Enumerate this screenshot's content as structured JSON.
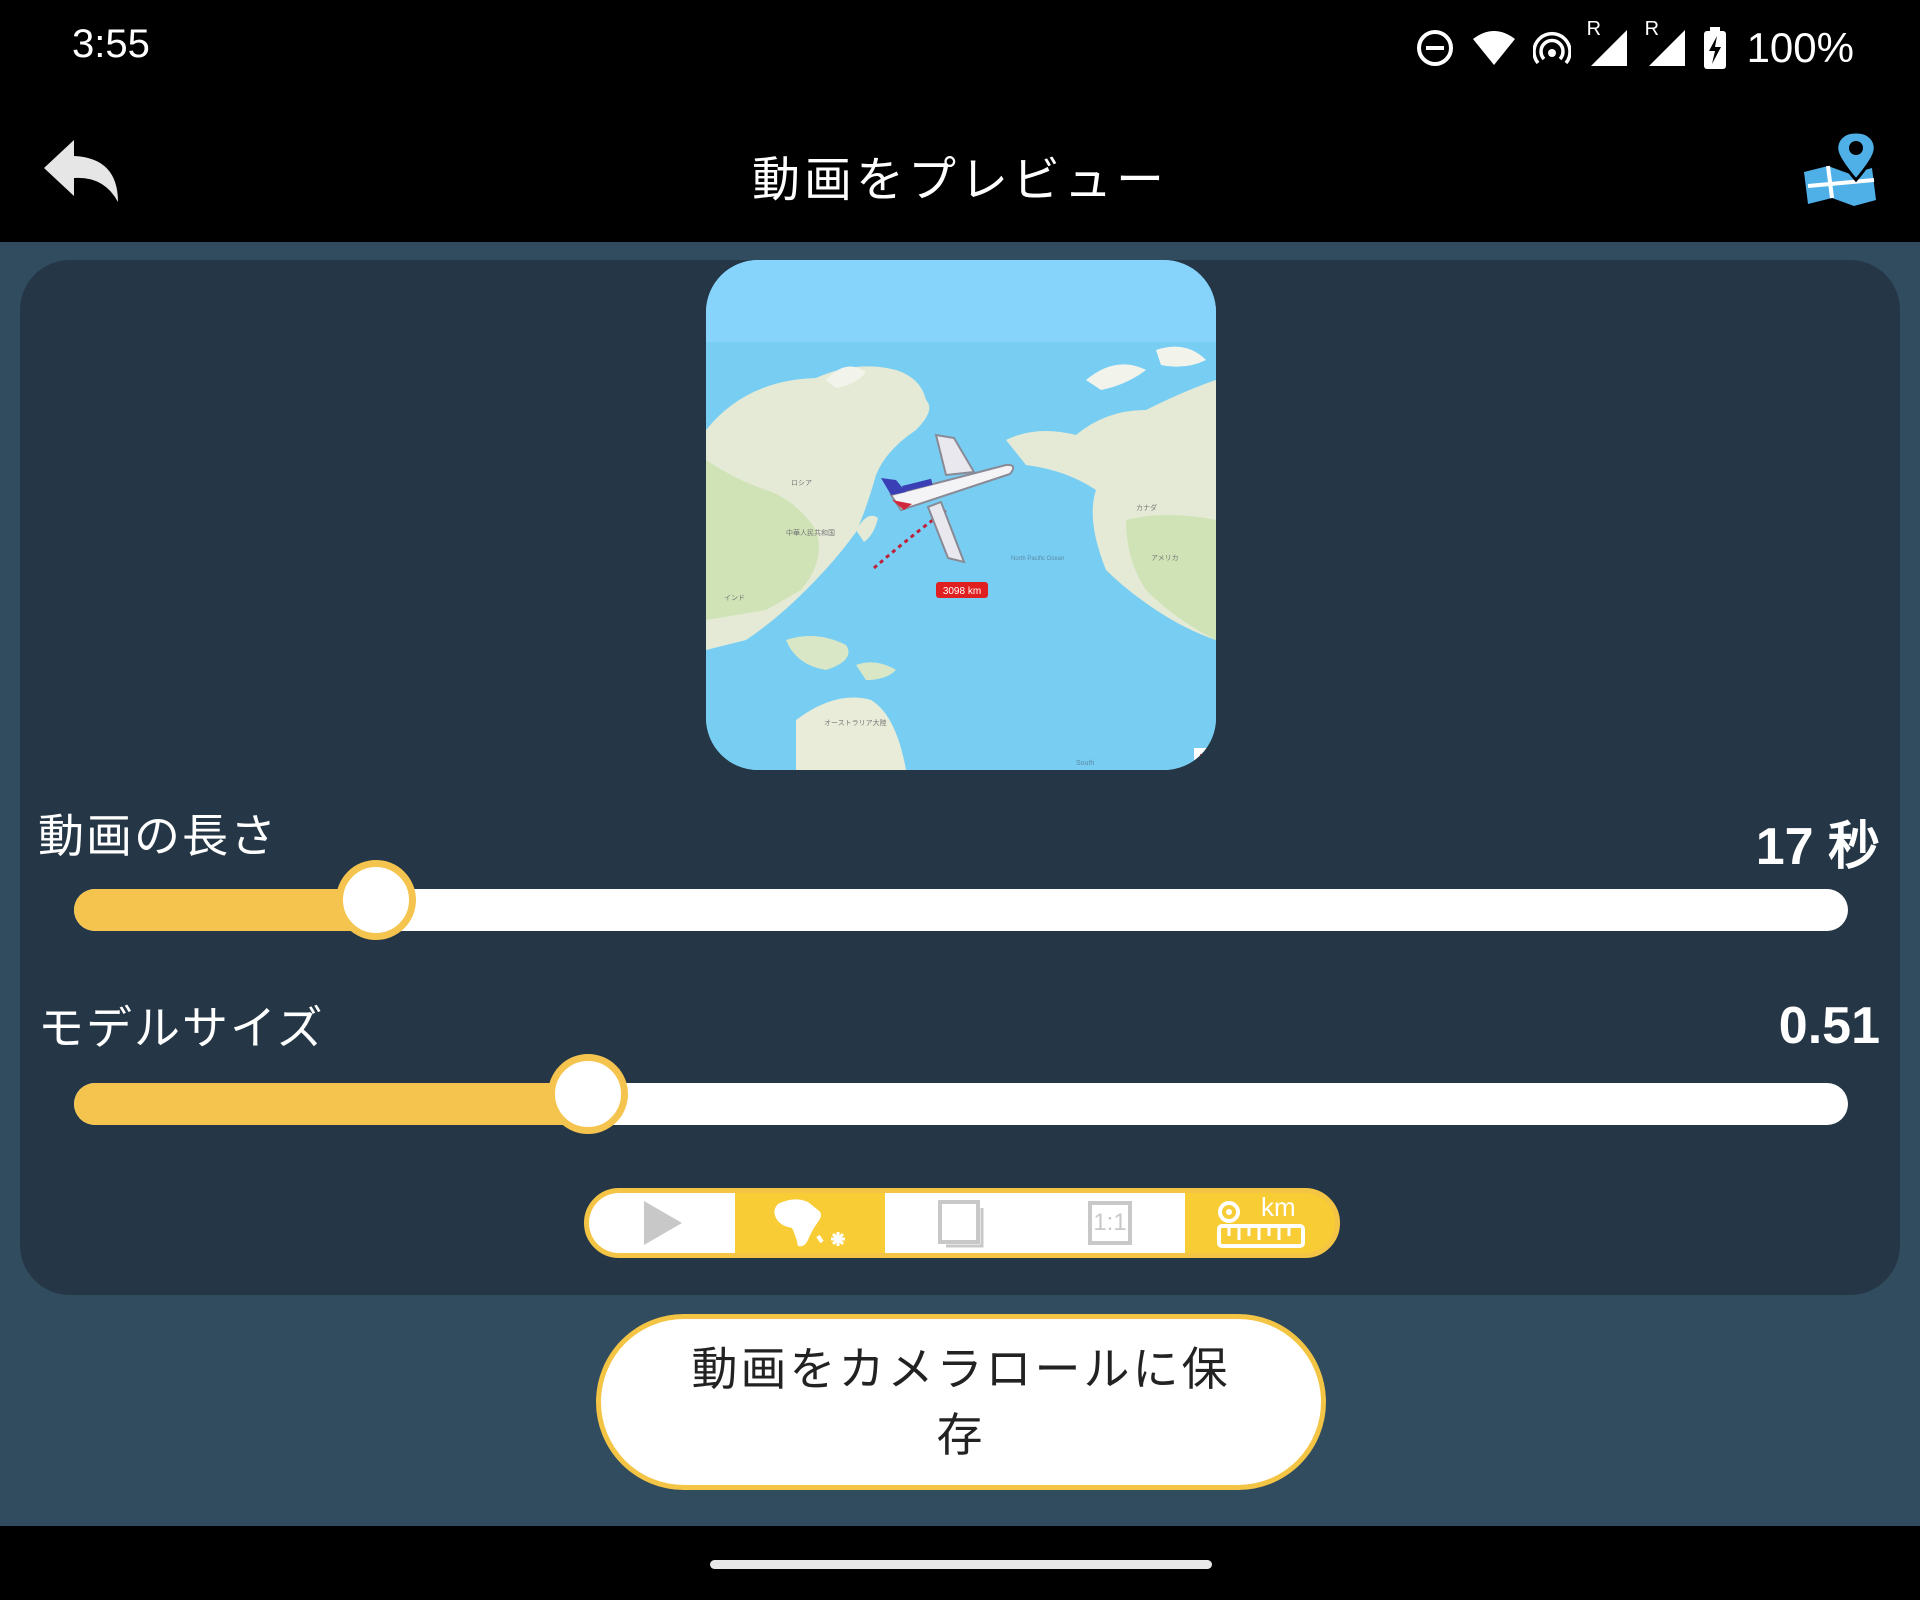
{
  "status_bar": {
    "time": "3:55",
    "battery": "100%",
    "roaming_label_1": "R",
    "roaming_label_2": "R"
  },
  "app_bar": {
    "title": "動画をプレビュー",
    "back_icon": "reply-arrow-icon",
    "action_icon": "map-location-pin-icon"
  },
  "preview": {
    "distance_label": "3098 km",
    "region_labels": [
      "ロシア",
      "中華人民共和国",
      "インド",
      "アメリカ",
      "カナダ",
      "オーストラリア大陸",
      "North Pacific Ocean",
      "South"
    ]
  },
  "sliders": {
    "duration": {
      "label": "動画の長さ",
      "value": "17 秒",
      "fraction": 0.17
    },
    "model_size": {
      "label": "モデルサイズ",
      "value": "0.51",
      "fraction": 0.29
    }
  },
  "segments": [
    {
      "icon": "play-icon",
      "selected": false
    },
    {
      "icon": "africa-map-icon",
      "selected": true
    },
    {
      "icon": "frame-icon",
      "selected": false
    },
    {
      "icon": "aspect-ratio-icon",
      "label": "1:1",
      "selected": false
    },
    {
      "icon": "distance-ruler-icon",
      "label": "km",
      "selected": true
    }
  ],
  "save_button": {
    "label": "動画をカメラロールに保存"
  },
  "colors": {
    "accent": "#f4c44e",
    "background": "#314b5f",
    "panel": "#253746",
    "bars": "#000000",
    "pin_blue": "#4fb0e8",
    "ocean": "#7fd0f8"
  }
}
